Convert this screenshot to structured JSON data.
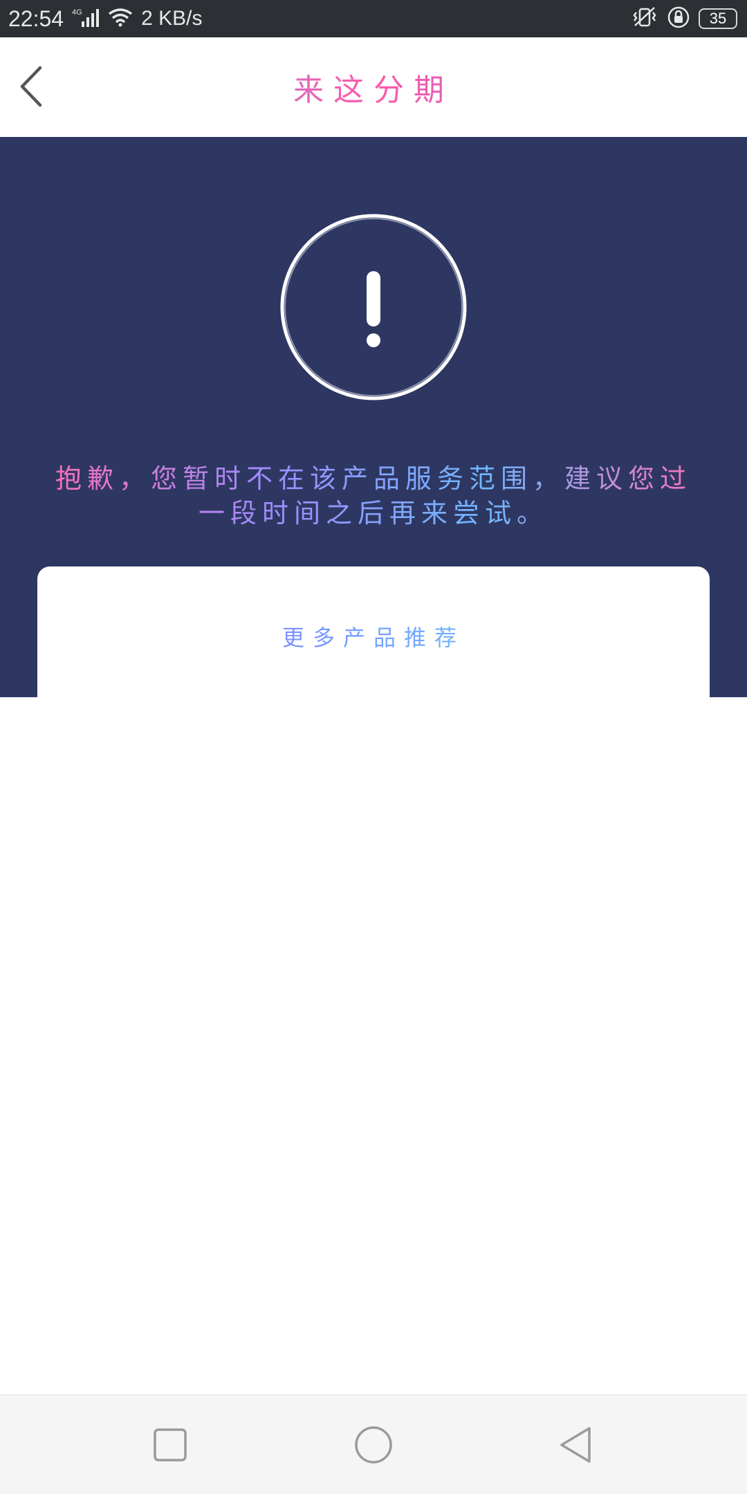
{
  "status_bar": {
    "time": "22:54",
    "signal": "4G",
    "net_speed": "2 KB/s",
    "battery": "35",
    "icons": [
      "signal-icon",
      "wifi-icon",
      "vibrate-icon",
      "rotation-lock-icon",
      "battery-icon"
    ]
  },
  "header": {
    "title": "来这分期",
    "back_icon": "chevron-left-icon"
  },
  "alert": {
    "icon": "exclamation-circle-icon",
    "message": "抱歉，您暂时不在该产品服务范围，建议您过一段时间之后再来尝试。"
  },
  "card": {
    "title": "更多产品推荐"
  },
  "nav": {
    "icons": [
      "recent-apps-icon",
      "home-icon",
      "back-triangle-icon"
    ]
  },
  "colors": {
    "panel": "#2e3762",
    "status_bar": "#2c2f33",
    "nav_bar": "#f5f5f5"
  }
}
